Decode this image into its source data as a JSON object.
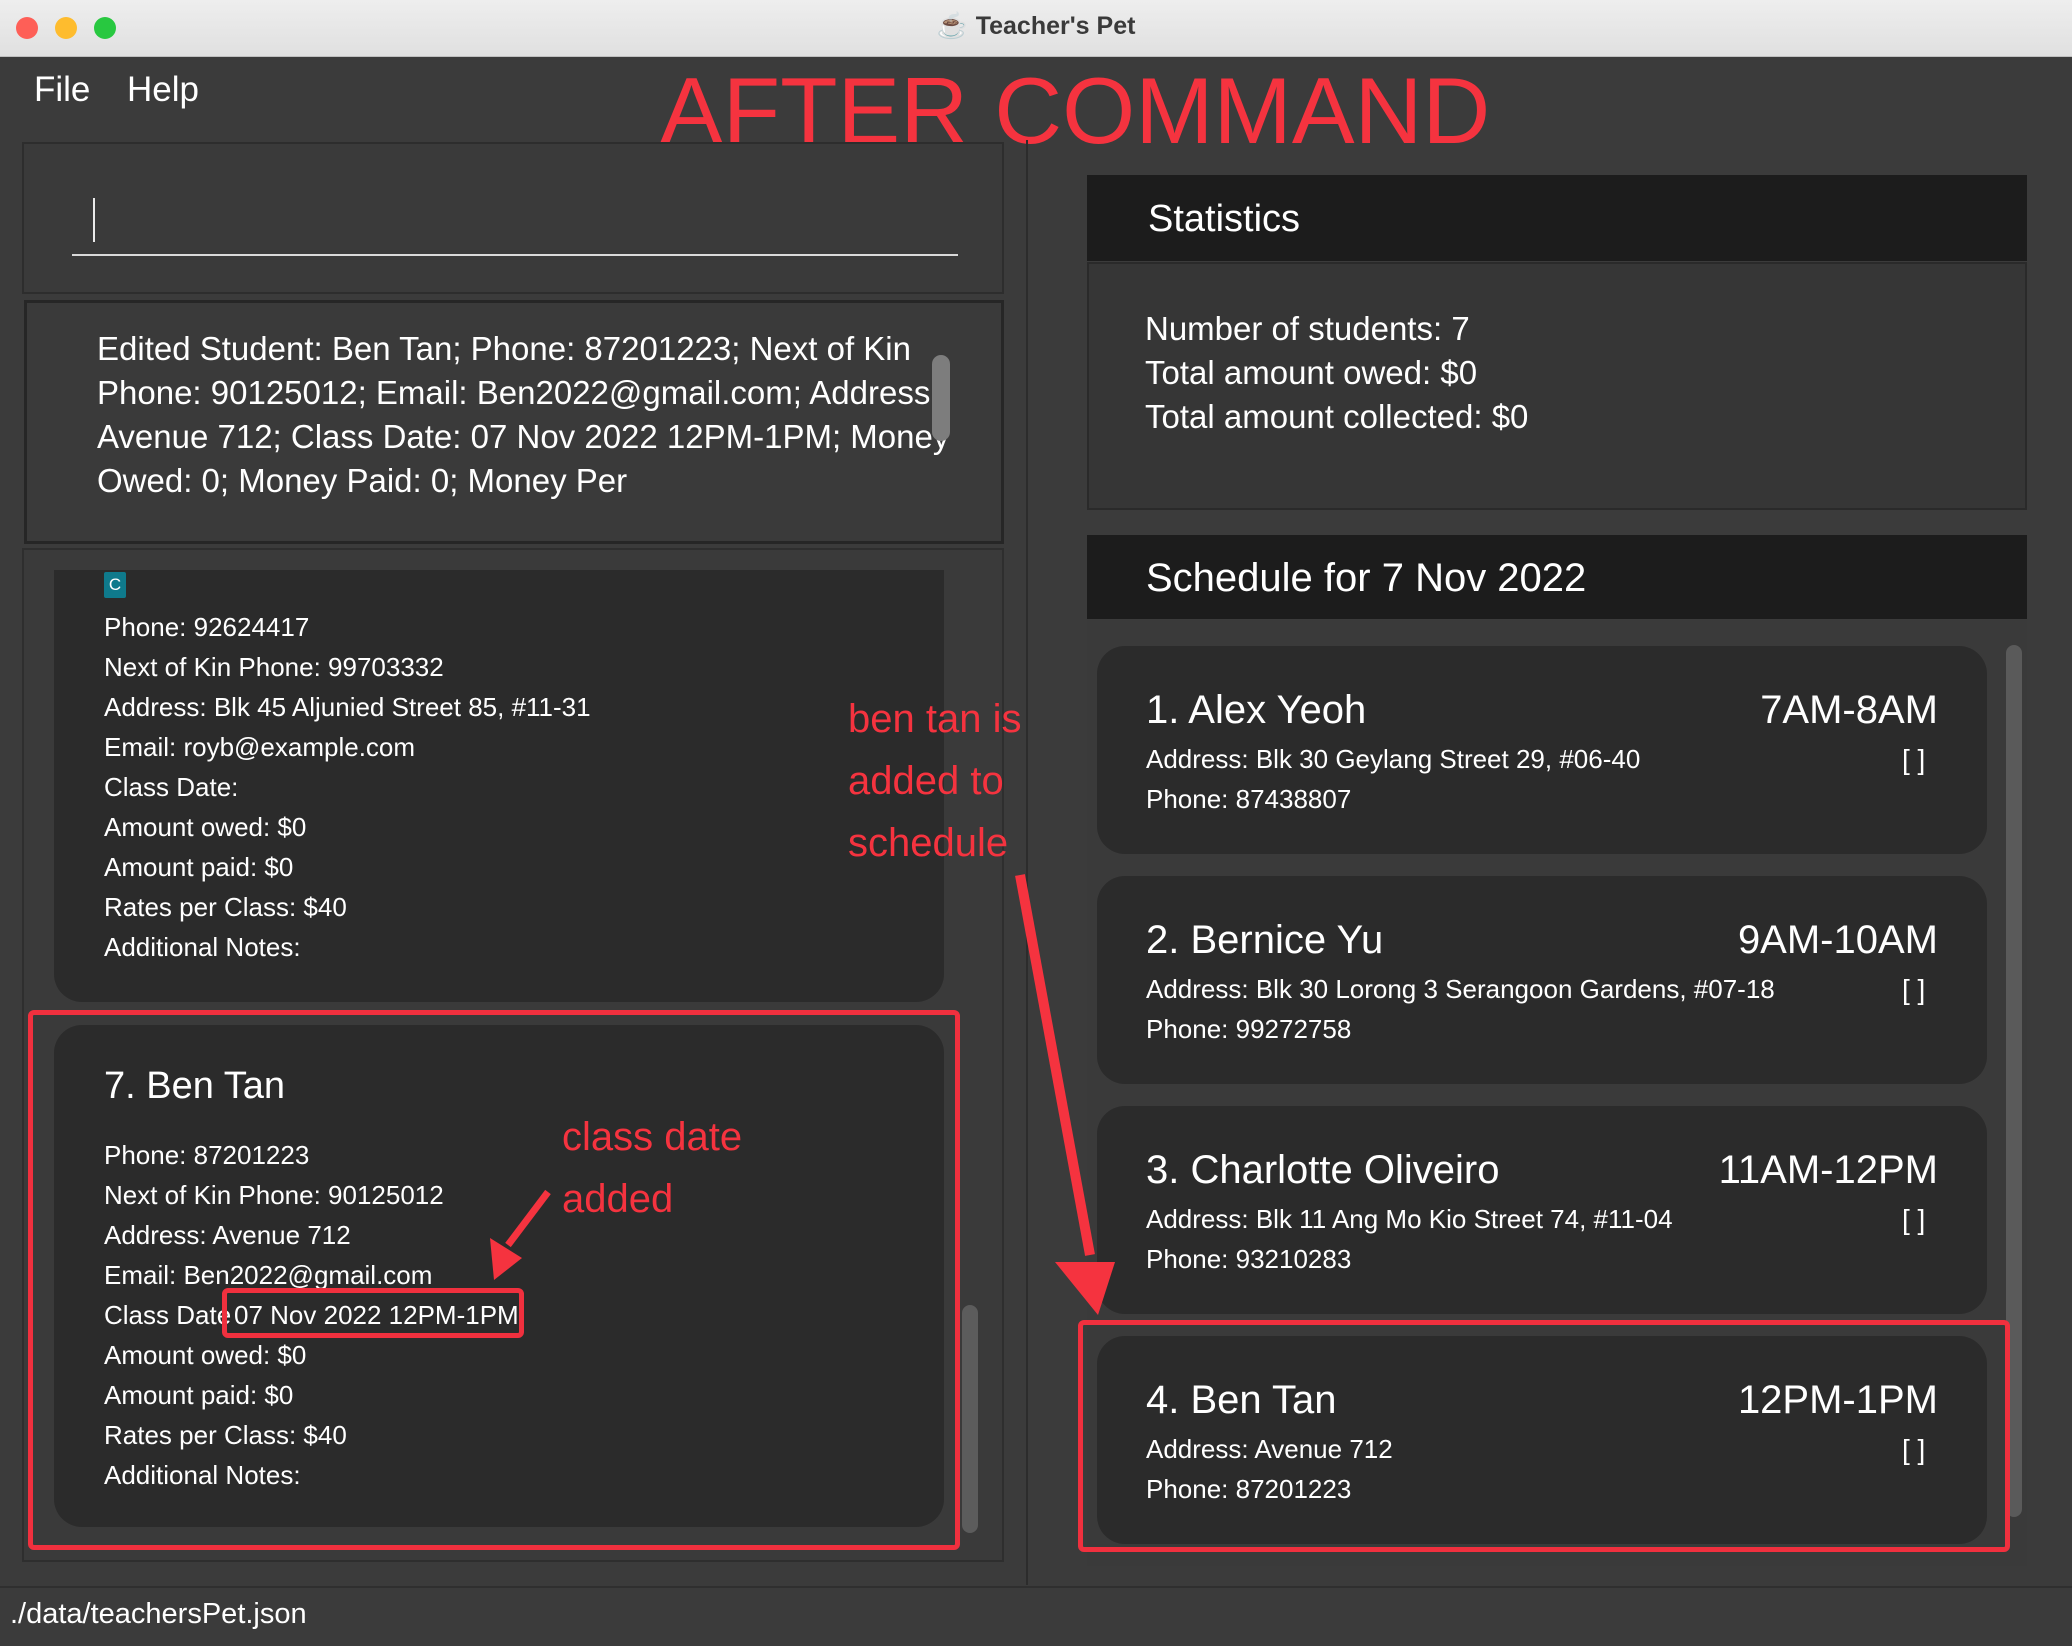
{
  "window": {
    "title": "Teacher's Pet"
  },
  "menu": {
    "file": "File",
    "help": "Help"
  },
  "annotations": {
    "banner": "AFTER COMMAND",
    "schedule_note_1": "ben tan is",
    "schedule_note_2": "added to",
    "schedule_note_3": "schedule",
    "class_note_1": "class date",
    "class_note_2": "added"
  },
  "command": {
    "value": ""
  },
  "result": {
    "text": "Edited Student: Ben Tan; Phone: 87201223; Next of Kin Phone: 90125012; Email: Ben2022@gmail.com; Address: Avenue 712; Class Date: 07 Nov 2022 12PM-1PM; Money Owed: 0; Money Paid: 0; Money Per"
  },
  "students": [
    {
      "tag": "C",
      "phone": "Phone: 92624417",
      "nok": "Next of Kin Phone:  99703332",
      "address": "Address:  Blk 45 Aljunied Street 85, #11-31",
      "email": "Email:  royb@example.com",
      "class_date": "Class Date:",
      "owed": "Amount owed: $0",
      "paid": "Amount paid: $0",
      "rates": "Rates per Class: $40",
      "notes": "Additional Notes:"
    },
    {
      "name": "7.  Ben Tan",
      "phone": "Phone: 87201223",
      "nok": "Next of Kin Phone:  90125012",
      "address": "Address:  Avenue 712",
      "email": "Email:  Ben2022@gmail.com",
      "class_date_label": "Class Date",
      "class_date_value": "07 Nov 2022 12PM-1PM",
      "owed": "Amount owed: $0",
      "paid": "Amount paid: $0",
      "rates": "Rates per Class: $40",
      "notes": "Additional Notes:"
    }
  ],
  "statistics": {
    "title": "Statistics",
    "students": "Number of students: 7",
    "owed": "Total amount owed: $0",
    "collected": "Total amount collected: $0"
  },
  "schedule": {
    "title": "Schedule for 7 Nov 2022",
    "items": [
      {
        "name": "1.  Alex Yeoh",
        "time": "7AM-8AM",
        "address": "Address:  Blk 30 Geylang Street 29, #06-40",
        "phone": "Phone: 87438807",
        "check": "[ ]"
      },
      {
        "name": "2.  Bernice Yu",
        "time": "9AM-10AM",
        "address": "Address:  Blk 30 Lorong 3 Serangoon Gardens, #07-18",
        "phone": "Phone: 99272758",
        "check": "[ ]"
      },
      {
        "name": "3.  Charlotte Oliveiro",
        "time": "11AM-12PM",
        "address": "Address:  Blk 11 Ang Mo Kio Street 74, #11-04",
        "phone": "Phone: 93210283",
        "check": "[ ]"
      },
      {
        "name": "4.  Ben Tan",
        "time": "12PM-1PM",
        "address": "Address:  Avenue 712",
        "phone": "Phone: 87201223",
        "check": "[ ]"
      }
    ]
  },
  "status": {
    "path": "./data/teachersPet.json"
  }
}
